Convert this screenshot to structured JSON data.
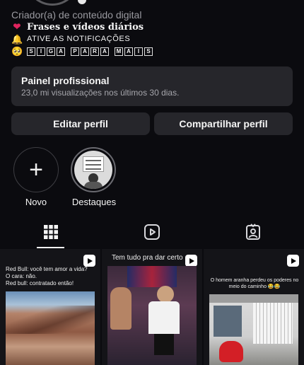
{
  "profile": {
    "category": "Criador(a) de conteúdo digital",
    "bio": [
      {
        "icon": "❤",
        "icon_name": "red-heart-icon",
        "text": "Frases e vídeos diários",
        "style": "serif"
      },
      {
        "icon": "🔔",
        "icon_name": "bell-icon",
        "text": "ATIVE AS NOTIFICAÇÕES",
        "style": "caps"
      },
      {
        "icon": "🥺",
        "icon_name": "pleading-face-icon",
        "text": "SIGA PARA MAIS",
        "style": "boxed"
      }
    ]
  },
  "pro_panel": {
    "title": "Painel profissional",
    "subtitle": "23,0 mi visualizações nos últimos 30 dias."
  },
  "actions": {
    "edit_label": "Editar perfil",
    "share_label": "Compartilhar perfil"
  },
  "highlights": {
    "new_label": "Novo",
    "new_symbol": "+",
    "destaques_label": "Destaques"
  },
  "tabs": [
    {
      "name": "tab-posts",
      "icon": "grid-icon",
      "selected": true
    },
    {
      "name": "tab-reels",
      "icon": "reels-icon",
      "selected": false
    },
    {
      "name": "tab-tagged",
      "icon": "tagged-icon",
      "selected": false
    }
  ],
  "posts": [
    {
      "caption": "Red Bull: você tem amor a vida?\nO cara: não.\nRed bull: contratado então!",
      "type": "reel"
    },
    {
      "caption": "Tem tudo pra dar certo",
      "type": "reel"
    },
    {
      "caption": "O homem aranha perdeu os poderes no meio do caminho 😂😂",
      "type": "reel"
    }
  ],
  "colors": {
    "background": "#0b0b0f",
    "panel": "#26262b",
    "text": "#f5f5f5",
    "muted": "#a6a6ac"
  }
}
